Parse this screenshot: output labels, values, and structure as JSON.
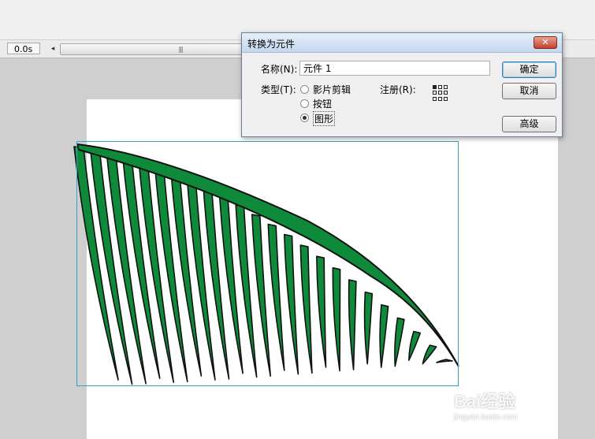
{
  "timeline": {
    "time": "0.0s",
    "scroll_left_glyph": "◂",
    "grip_glyph": "|||"
  },
  "dialog": {
    "title": "转换为元件",
    "close_glyph": "✕",
    "name_label": "名称(N):",
    "name_value": "元件 1",
    "type_label": "类型(T):",
    "types": [
      "影片剪辑",
      "按钮",
      "图形"
    ],
    "selected_type": "图形",
    "registration_label": "注册(R):",
    "buttons": {
      "ok": "确定",
      "cancel": "取消",
      "advanced": "高级"
    }
  },
  "artwork": {
    "fill_color": "#0f8a3a",
    "stroke_color": "#111111",
    "bbox_color": "#3aa1c4"
  },
  "watermark": {
    "brand": "Bai经验",
    "url": "jingyan.baidu.com"
  }
}
